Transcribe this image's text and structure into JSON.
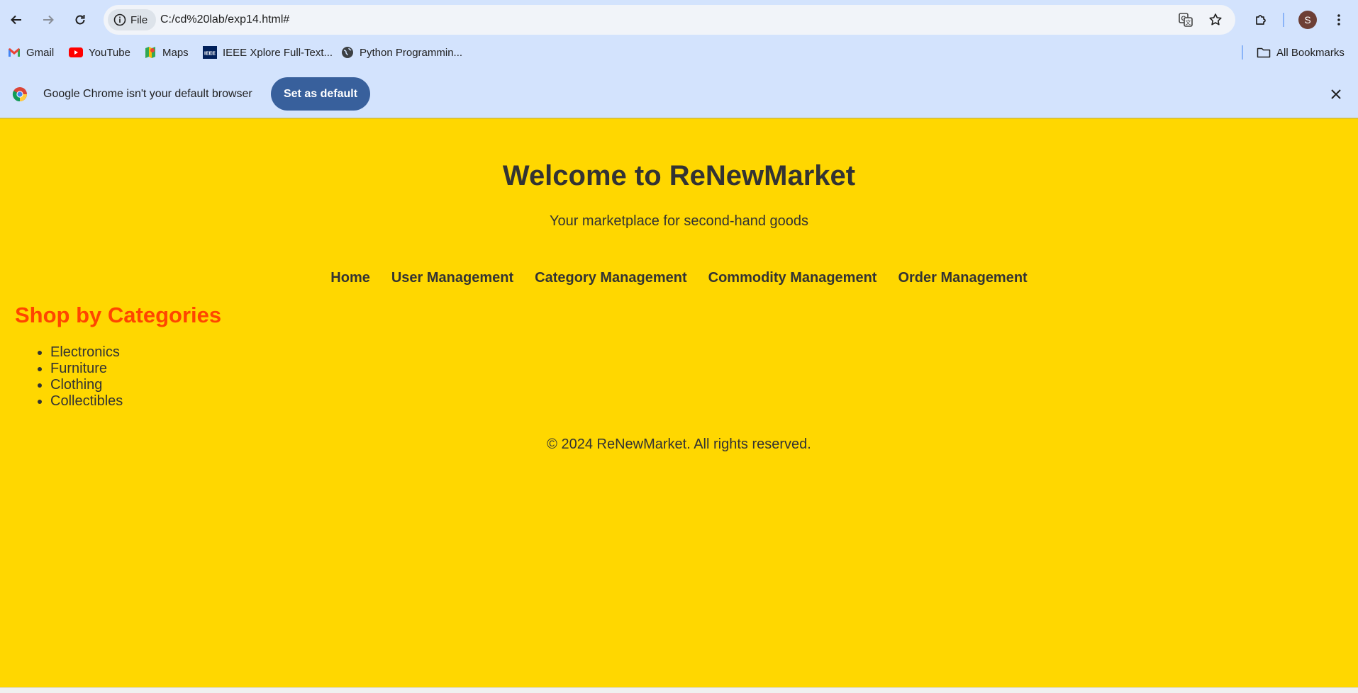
{
  "browser": {
    "url": "C:/cd%20lab/exp14.html#",
    "site_chip_label": "File",
    "profile_initial": "S",
    "bookmarks": [
      {
        "label": "Gmail",
        "icon": "gmail-icon"
      },
      {
        "label": "YouTube",
        "icon": "youtube-icon"
      },
      {
        "label": "Maps",
        "icon": "maps-icon"
      },
      {
        "label": "IEEE Xplore Full-Text...",
        "icon": "ieee-icon"
      },
      {
        "label": "Python Programmin...",
        "icon": "globe-icon"
      }
    ],
    "all_bookmarks_label": "All Bookmarks",
    "infobar": {
      "message": "Google Chrome isn't your default browser",
      "button_label": "Set as default"
    }
  },
  "page": {
    "title": "Welcome to ReNewMarket",
    "tagline": "Your marketplace for second-hand goods",
    "nav": [
      "Home",
      "User Management",
      "Category Management",
      "Commodity Management",
      "Order Management"
    ],
    "categories_heading": "Shop by Categories",
    "categories": [
      "Electronics",
      "Furniture",
      "Clothing",
      "Collectibles"
    ],
    "footer": "© 2024 ReNewMarket. All rights reserved."
  },
  "colors": {
    "page_background": "#ffd700",
    "heading_accent": "#ff4500",
    "text": "#333333",
    "chrome_background": "#d3e3fd",
    "primary_button": "#38609c"
  }
}
